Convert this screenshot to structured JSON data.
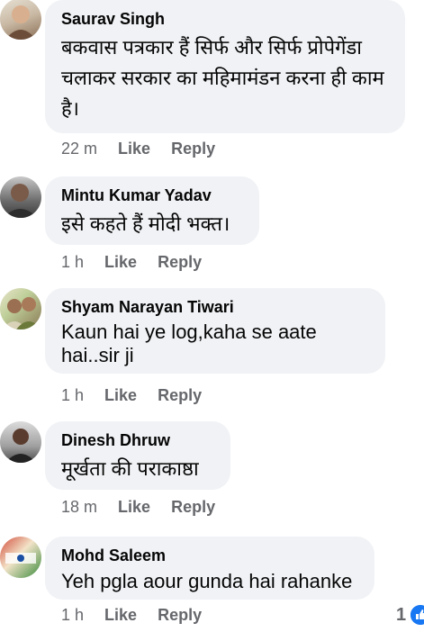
{
  "comments": [
    {
      "author": "Saurav Singh",
      "text": "बकवास पत्रकार हैं सिर्फ और सिर्फ प्रोपेगेंडा चलाकर सरकार का महिमामंडन करना ही काम है।",
      "time": "22 m",
      "like": "Like",
      "reply": "Reply"
    },
    {
      "author": "Mintu Kumar Yadav",
      "text": "इसे कहते हैं मोदी भक्त।",
      "time": "1 h",
      "like": "Like",
      "reply": "Reply"
    },
    {
      "author": "Shyam Narayan Tiwari",
      "text": "Kaun hai ye log,kaha se aate hai..sir ji",
      "time": "1 h",
      "like": "Like",
      "reply": "Reply"
    },
    {
      "author": "Dinesh Dhruw",
      "text": "मूर्खता की पराकाष्ठा",
      "time": "18 m",
      "like": "Like",
      "reply": "Reply"
    },
    {
      "author": "Mohd Saleem",
      "text": "Yeh pgla aour gunda hai rahanke",
      "time": "1 h",
      "like": "Like",
      "reply": "Reply"
    }
  ],
  "reactions": {
    "count": "1"
  },
  "colors": {
    "bubble": "#f0f2f5",
    "meta": "#65676b",
    "accent": "#1877f2"
  }
}
